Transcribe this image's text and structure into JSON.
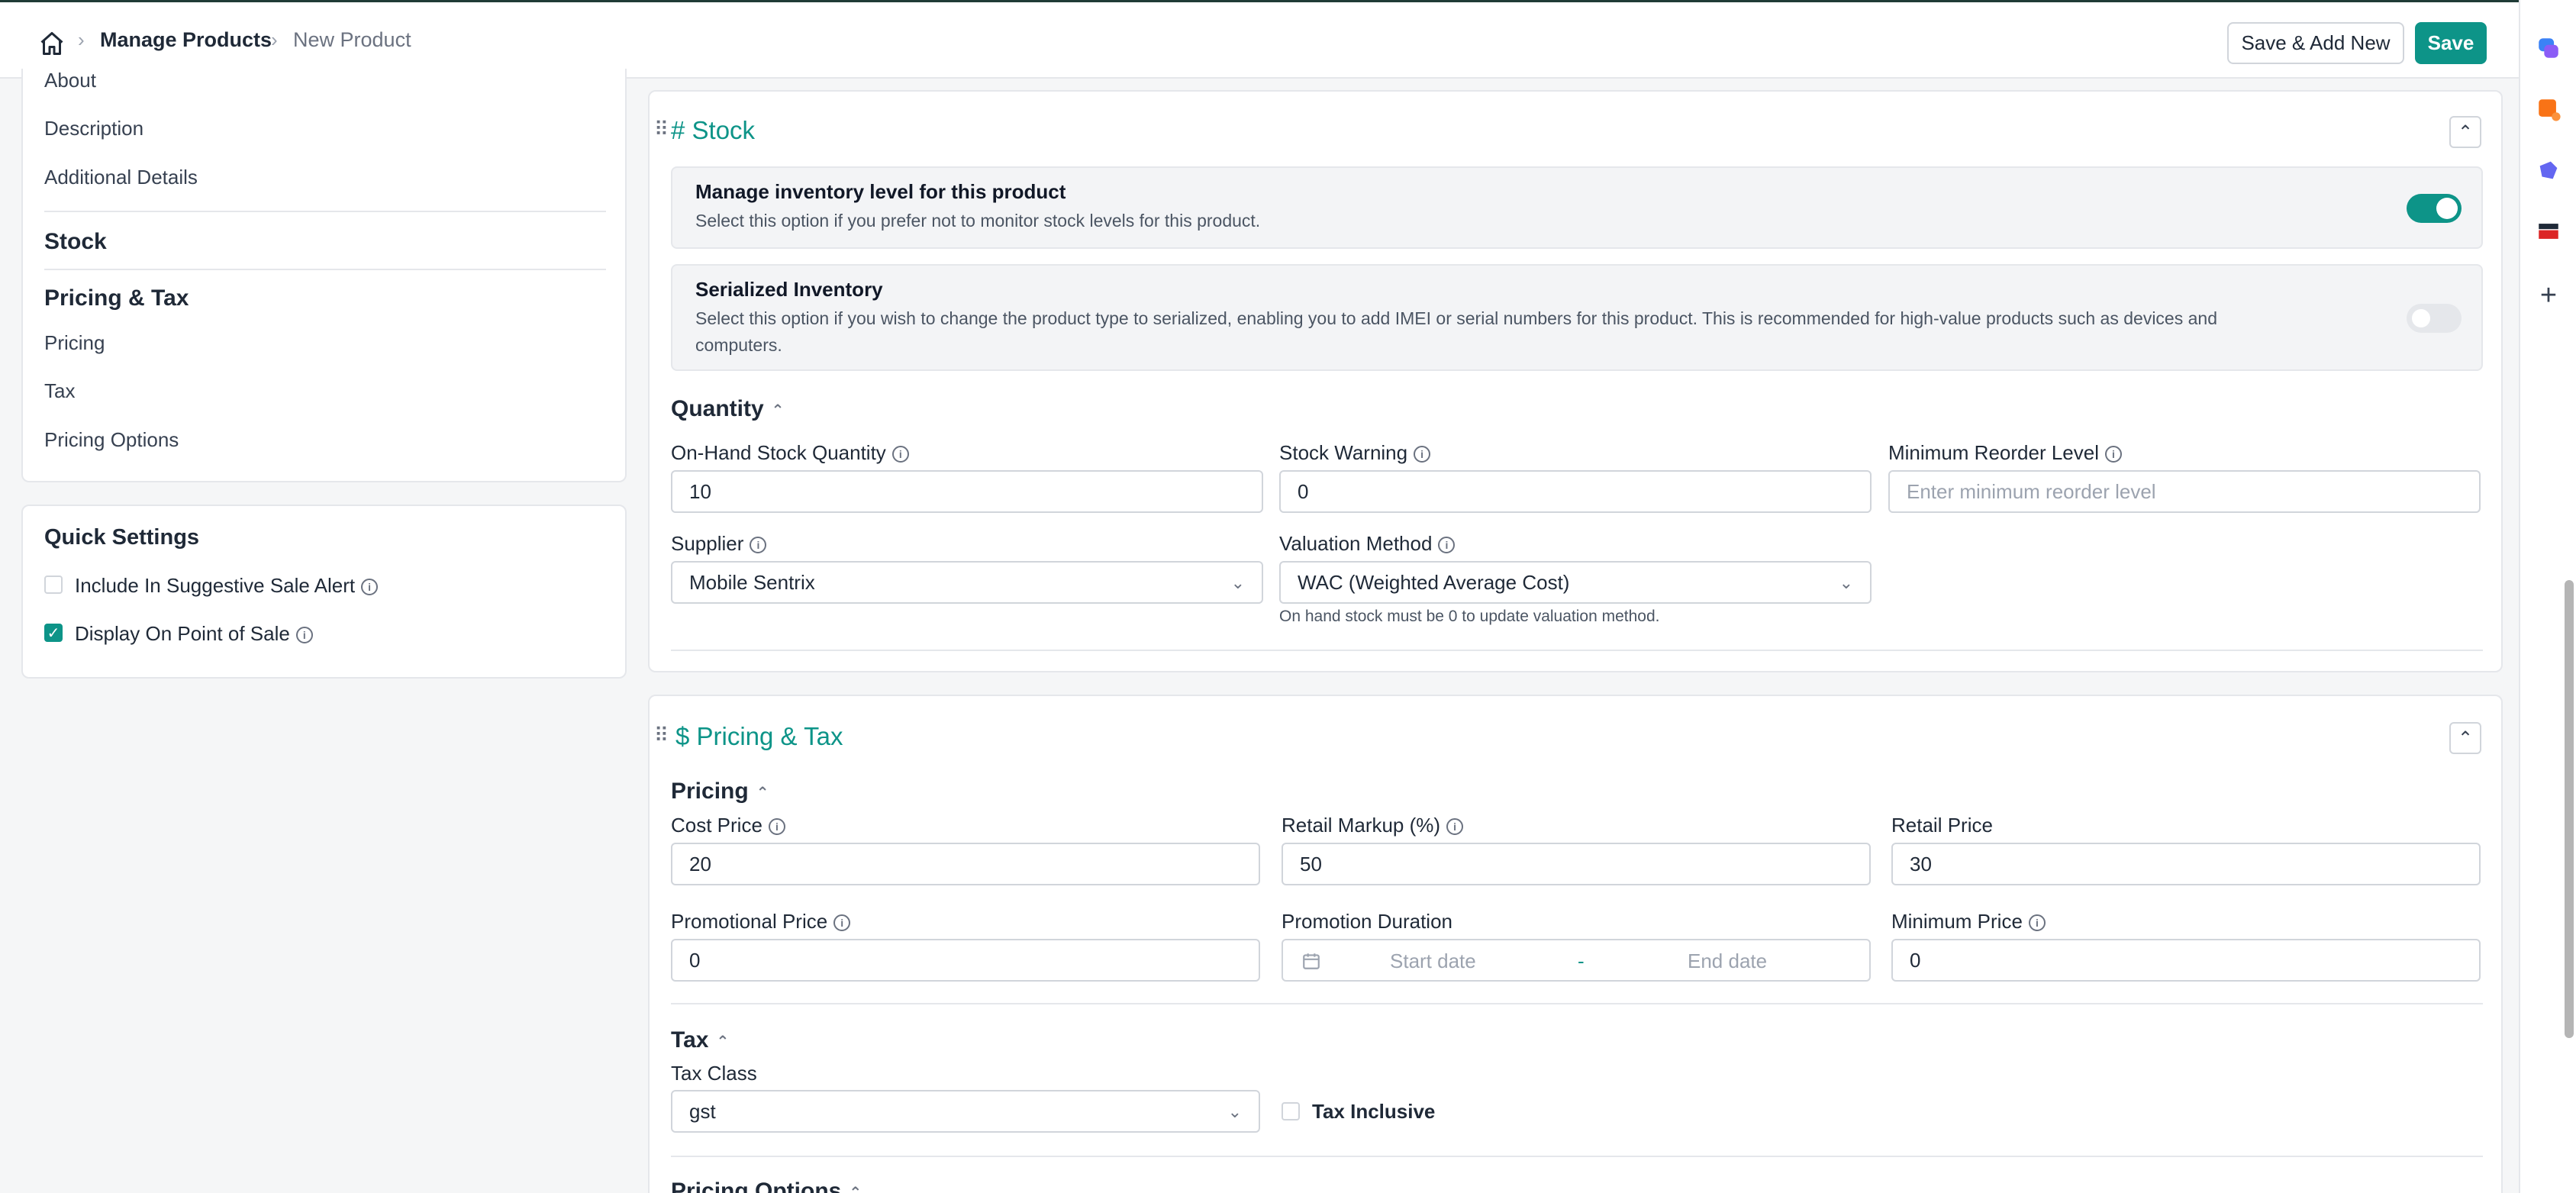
{
  "breadcrumb": {
    "home_icon": "home-icon",
    "parent": "Manage Products",
    "current": "New Product",
    "separator": "›"
  },
  "actions": {
    "save_add_new": "Save & Add New",
    "save": "Save"
  },
  "sidebar": {
    "items_top": [
      "About",
      "Description",
      "Additional Details"
    ],
    "stock_heading": "Stock",
    "pricing_heading": "Pricing & Tax",
    "pricing_items": [
      "Pricing",
      "Tax",
      "Pricing Options"
    ]
  },
  "quick_settings": {
    "title": "Quick Settings",
    "options": [
      {
        "label": "Include In Suggestive Sale Alert",
        "checked": false
      },
      {
        "label": "Display On Point of Sale",
        "checked": true
      }
    ]
  },
  "stock": {
    "title": "# Stock",
    "manage_inventory": {
      "title": "Manage inventory level for this product",
      "desc": "Select this option if you prefer not to monitor stock levels for this product.",
      "enabled": true
    },
    "serialized": {
      "title": "Serialized Inventory",
      "desc_line1": "Select this option if you wish to change the product type to serialized, enabling you to add IMEI or serial numbers for this product. This is recommended for high-value products such as devices and",
      "desc_line2": "computers.",
      "enabled": false
    },
    "quantity_heading": "Quantity",
    "fields": {
      "on_hand_label": "On-Hand Stock Quantity",
      "on_hand_value": "10",
      "stock_warning_label": "Stock Warning",
      "stock_warning_value": "0",
      "min_reorder_label": "Minimum Reorder Level",
      "min_reorder_placeholder": "Enter minimum reorder level",
      "supplier_label": "Supplier",
      "supplier_value": "Mobile Sentrix",
      "valuation_label": "Valuation Method",
      "valuation_value": "WAC (Weighted Average Cost)",
      "valuation_hint": "On hand stock must be 0 to update valuation method."
    }
  },
  "pricing_tax": {
    "title": "$ Pricing & Tax",
    "pricing_heading": "Pricing",
    "cost_label": "Cost Price",
    "cost_value": "20",
    "markup_label": "Retail Markup (%)",
    "markup_value": "50",
    "retail_label": "Retail Price",
    "retail_value": "30",
    "promo_label": "Promotional Price",
    "promo_value": "0",
    "duration_label": "Promotion Duration",
    "start_placeholder": "Start date",
    "end_placeholder": "End date",
    "range_sep": "-",
    "min_price_label": "Minimum Price",
    "min_price_value": "0",
    "tax_heading": "Tax",
    "tax_class_label": "Tax Class",
    "tax_class_value": "gst",
    "tax_inclusive_label": "Tax Inclusive",
    "pricing_options_heading": "Pricing Options"
  },
  "icons": {
    "info": "i",
    "collapse": "⌃",
    "chevron_down": "⌄",
    "chevron_up": "⌃",
    "drag": "⠿",
    "calendar": "calendar-icon",
    "plus": "+"
  },
  "colors": {
    "accent": "#0d9488",
    "header_border": "#1f3b36"
  }
}
